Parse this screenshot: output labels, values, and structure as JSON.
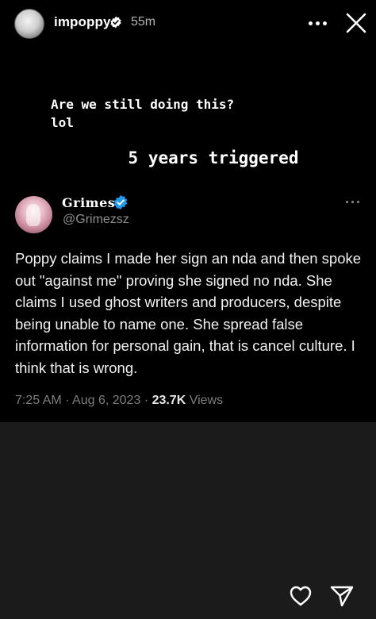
{
  "story": {
    "username": "impoppy",
    "time_ago": "55m",
    "caption_line1": "Are we still doing this?",
    "caption_line2": "lol",
    "caption_main": "5 years triggered"
  },
  "tweet": {
    "display_name": "Grimes",
    "handle": "@Grimezsz",
    "body": "Poppy claims I made her sign an nda and then spoke out \"against me\" proving she signed no nda.  She claims I used ghost writers and producers, despite being unable to name one. She spread false information for personal gain, that is cancel culture.  I think that is wrong.",
    "time": "7:25 AM",
    "date": "Aug 6, 2023",
    "views_count": "23.7K",
    "views_label": "Views"
  },
  "colors": {
    "verified_blue": "#1d9bf0",
    "background": "#000000",
    "story_bg": "#1b1b1b"
  },
  "icons": {
    "more": "more-horizontal-icon",
    "close": "close-icon",
    "like": "heart-outline-icon",
    "share": "send-icon"
  }
}
